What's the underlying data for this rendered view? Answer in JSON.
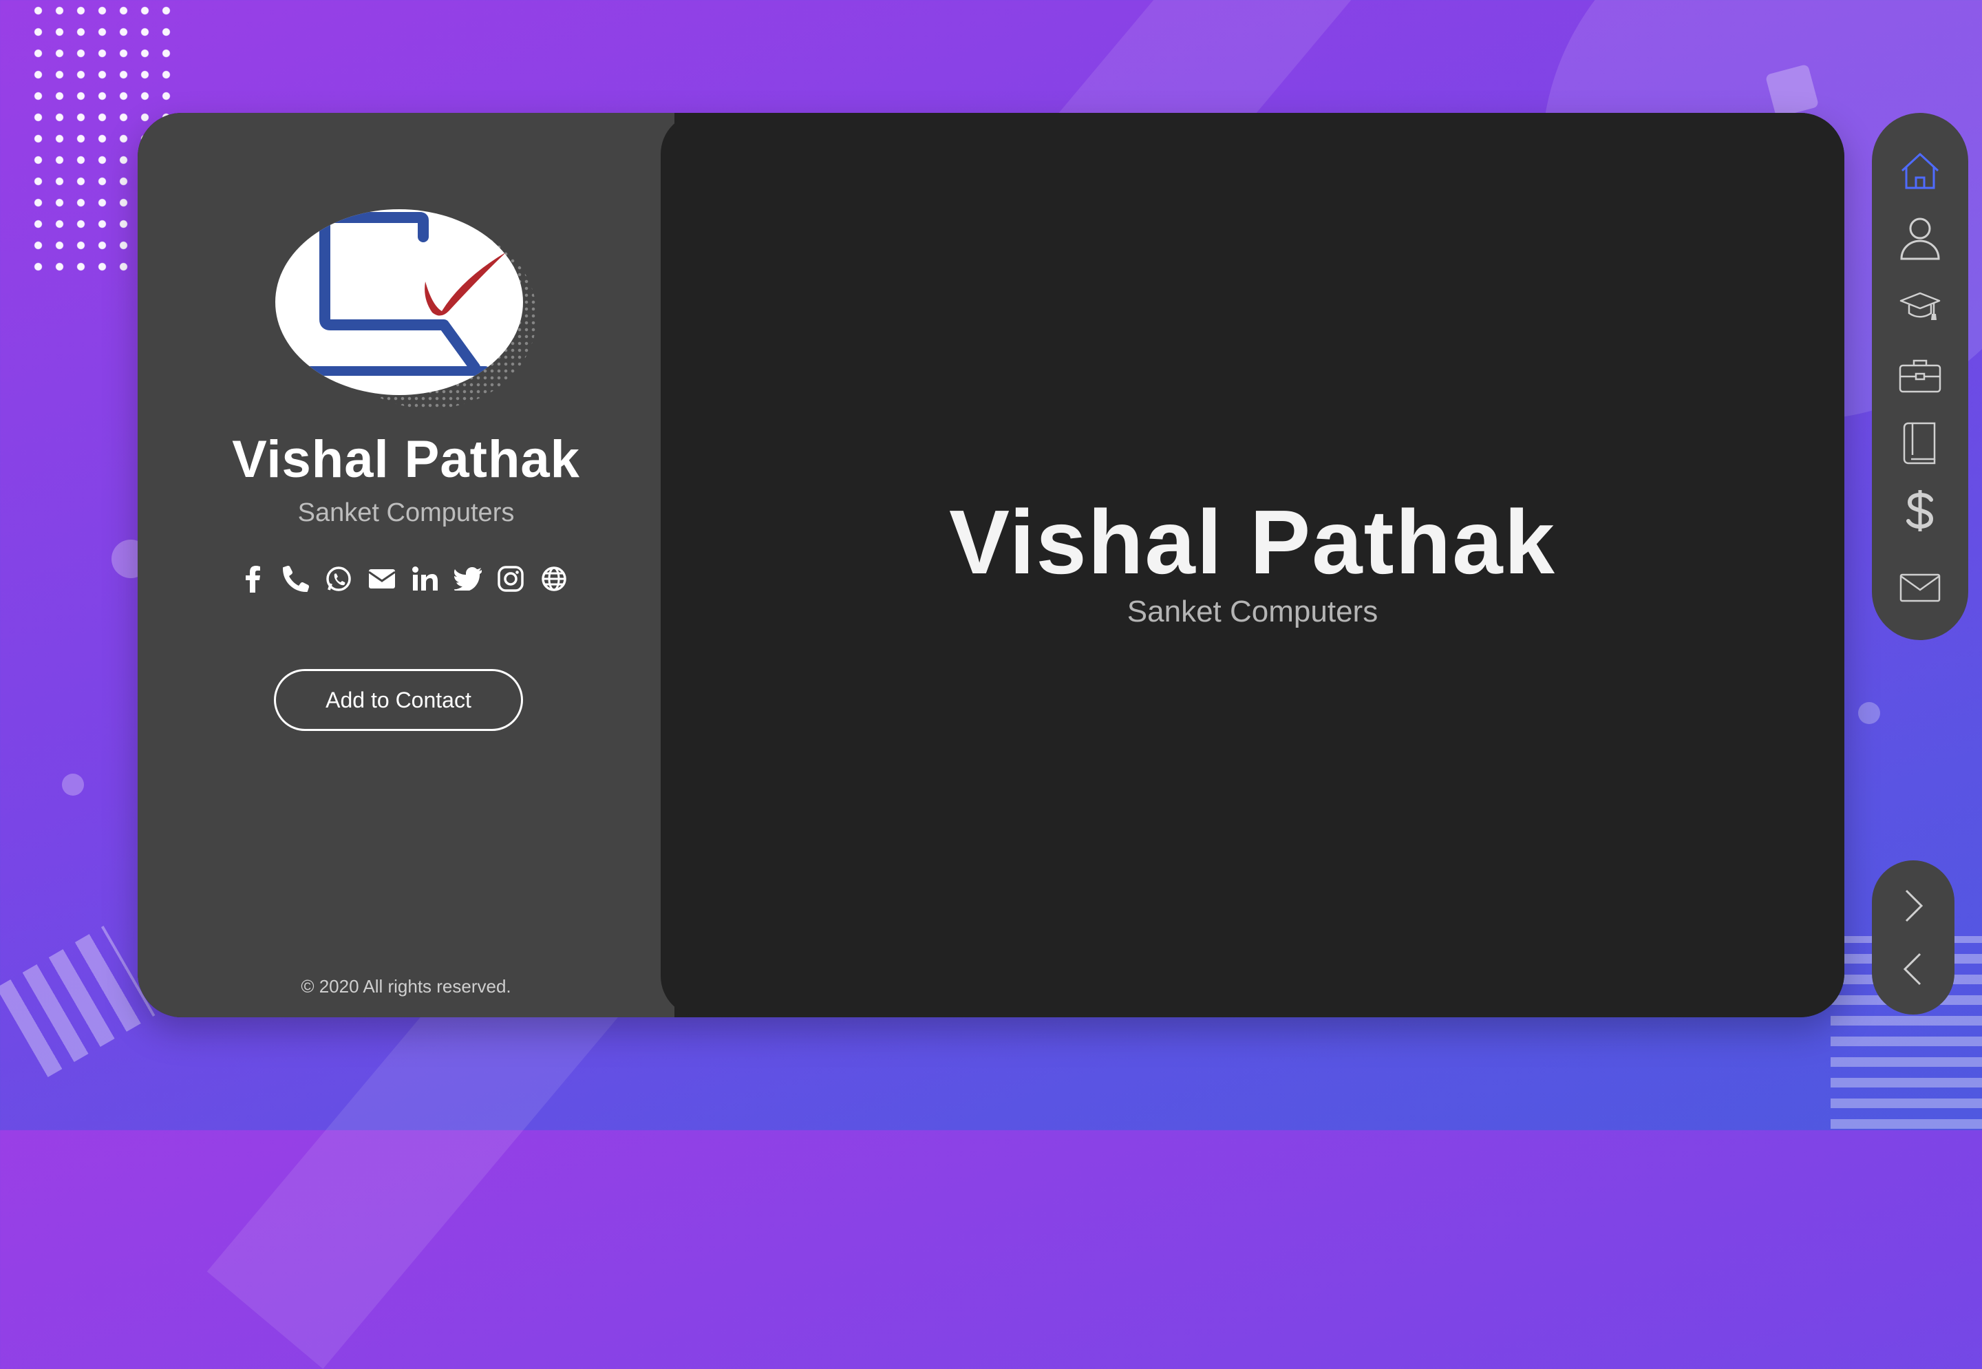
{
  "profile": {
    "name": "Vishal Pathak",
    "company": "Sanket Computers",
    "add_contact_label": "Add to Contact",
    "footer": "© 2020 All rights reserved."
  },
  "hero": {
    "name": "Vishal Pathak",
    "company": "Sanket Computers"
  },
  "social_icons": [
    "facebook-icon",
    "phone-icon",
    "whatsapp-icon",
    "email-icon",
    "linkedin-icon",
    "twitter-icon",
    "instagram-icon",
    "globe-icon"
  ],
  "nav_icons": [
    "home-icon",
    "user-icon",
    "graduation-cap-icon",
    "briefcase-icon",
    "book-icon",
    "dollar-icon",
    "mail-icon"
  ],
  "pager_icons": [
    "chevron-right-icon",
    "chevron-left-icon"
  ],
  "colors": {
    "accent": "#4f6bff",
    "card": "#222222",
    "panel": "#444444",
    "logo_blue": "#2f4fa2",
    "logo_red": "#b3282d"
  }
}
